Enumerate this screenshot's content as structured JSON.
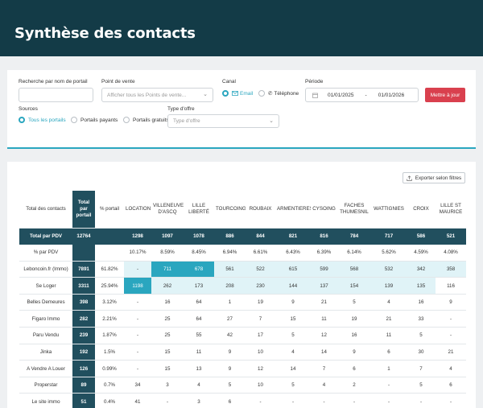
{
  "header": {
    "title": "Synthèse des contacts"
  },
  "filters": {
    "search_label": "Recherche par nom de portail",
    "search_value": "",
    "pdv_label": "Point de vente",
    "pdv_placeholder": "Afficher tous les Points de vente...",
    "canal_label": "Canal",
    "canal_email": "Email",
    "canal_phone": "Téléphone",
    "periode_label": "Période",
    "date_from": "01/01/2025",
    "date_sep": "-",
    "date_to": "01/01/2026",
    "apply_button": "Mettre à jour",
    "sources_label": "Sources",
    "sources_all": "Tous les portails",
    "sources_paid": "Portails payants",
    "sources_free": "Portails gratuits",
    "type_label": "Type d'offre",
    "type_placeholder": "Type d'offre"
  },
  "table": {
    "export_label": "Exporter selon filtres",
    "headers": [
      "Total des contacts",
      "Total par portail",
      "% portail",
      "LOCATION",
      "VILLENEUVE D'ASCQ",
      "LILLE LIBERTÉ",
      "TOURCOING",
      "ROUBAIX",
      "ARMENTIERES",
      "CYSOING",
      "FACHES THUMESNIL",
      "WATTIGNIES",
      "CROIX",
      "LILLE ST MAURICE"
    ],
    "total_row": [
      "Total par PDV",
      "12764",
      "",
      "1298",
      "1097",
      "1078",
      "886",
      "844",
      "821",
      "816",
      "784",
      "717",
      "586",
      "521"
    ],
    "pct_row": [
      "% par PDV",
      "",
      "",
      "10.17%",
      "8.59%",
      "8.45%",
      "6.94%",
      "6.61%",
      "6.43%",
      "6.39%",
      "6.14%",
      "5.62%",
      "4.59%",
      "4.08%"
    ],
    "rows": [
      [
        "Leboncoin.fr (Immo)",
        "7891",
        "61.82%",
        "-",
        "711",
        "678",
        "561",
        "522",
        "615",
        "599",
        "568",
        "532",
        "342",
        "358"
      ],
      [
        "Se Loger",
        "3311",
        "25.94%",
        "1198",
        "262",
        "173",
        "208",
        "230",
        "144",
        "137",
        "154",
        "139",
        "135",
        "116"
      ],
      [
        "Belles Demeures",
        "398",
        "3.12%",
        "-",
        "16",
        "64",
        "1",
        "19",
        "9",
        "21",
        "5",
        "4",
        "16",
        "9"
      ],
      [
        "Figaro Immo",
        "282",
        "2.21%",
        "-",
        "25",
        "64",
        "27",
        "7",
        "15",
        "11",
        "19",
        "21",
        "33",
        "-"
      ],
      [
        "Paru Vendu",
        "239",
        "1.87%",
        "-",
        "25",
        "55",
        "42",
        "17",
        "5",
        "12",
        "16",
        "11",
        "5",
        "-"
      ],
      [
        "Jinka",
        "192",
        "1.5%",
        "-",
        "15",
        "11",
        "9",
        "10",
        "4",
        "14",
        "9",
        "6",
        "30",
        "21"
      ],
      [
        "A Vendre A Louer",
        "126",
        "0.99%",
        "-",
        "15",
        "13",
        "9",
        "12",
        "14",
        "7",
        "6",
        "1",
        "7",
        "4"
      ],
      [
        "Properstar",
        "89",
        "0.7%",
        "34",
        "3",
        "4",
        "5",
        "10",
        "5",
        "4",
        "2",
        "-",
        "5",
        "6"
      ],
      [
        "Le site immo",
        "51",
        "0.4%",
        "41",
        "-",
        "3",
        "6",
        "-",
        "-",
        "-",
        "-",
        "-",
        "-",
        "-"
      ]
    ]
  },
  "colors": {
    "header_bg": "#133b47",
    "accent": "#2aa6bf",
    "total_bg": "#214f5e",
    "button_red": "#d9404e",
    "highlight_light": "#e0f3f7"
  },
  "icons": {
    "email": "envelope-icon",
    "phone": "phone-icon",
    "calendar": "calendar-icon",
    "export": "upload-icon",
    "dropdown": "chevron-down-icon"
  }
}
